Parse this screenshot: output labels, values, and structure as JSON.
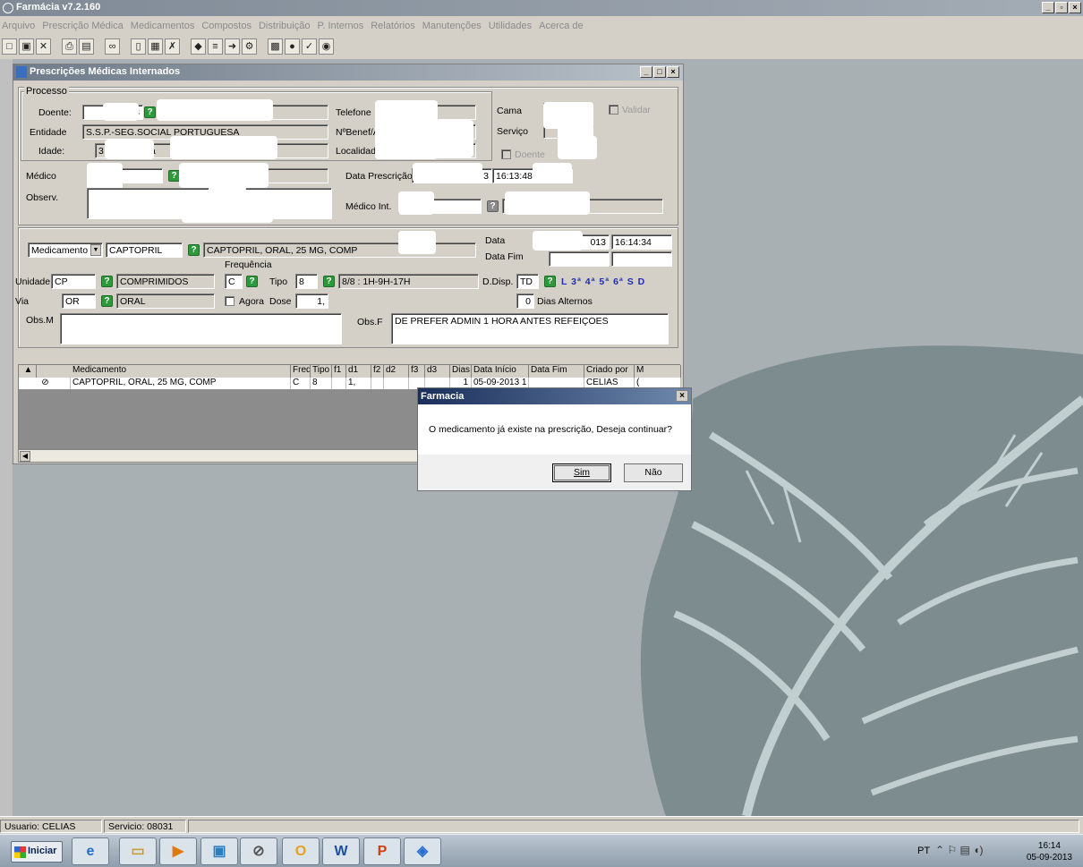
{
  "app": {
    "title": "Farmácia v7.2.160"
  },
  "menu": [
    "Arquivo",
    "Prescrição Médica",
    "Medicamentos",
    "Compostos",
    "Distribuição",
    "P. Internos",
    "Relatórios",
    "Manutenções",
    "Utilidades",
    "Acerca de"
  ],
  "toolbar": {
    "buttons": [
      "new-icon",
      "save-icon",
      "delete-icon",
      "print-icon",
      "print-preview-icon",
      "binoculars-icon",
      "page-icon",
      "export-icon",
      "excel-icon",
      "tool-icon",
      "tool-icon",
      "exit-icon",
      "tool-icon",
      "calculator-icon",
      "color-icon",
      "check-icon",
      "ok-icon"
    ]
  },
  "window": {
    "title": "Prescrições Médicas Internados"
  },
  "process": {
    "group_label": "Processo",
    "doente_label": "Doente:",
    "doente_value": "3",
    "entidade_label": "Entidade",
    "entidade_value": "S.S.P.-SEG.SOCIAL PORTUGUESA",
    "idade_label": "Idade:",
    "idade_value": "3",
    "idade_suffix": "a",
    "telefone_label": "Telefone",
    "nbenef_label": "NºBenef/A",
    "localidade_label": "Localidade:",
    "cama_label": "Cama",
    "validar_label": "Validar",
    "servico_label": "Serviço",
    "doente_chk_label": "Doente",
    "medico_label": "Médico",
    "observ_label": "Observ.",
    "data_prescricao_label": "Data Prescrição",
    "data_prescricao_date": "3",
    "data_prescricao_time": "16:13:48",
    "medico_int_label": "Médico Int."
  },
  "med": {
    "type_select": "Medicamento",
    "code": "CAPTOPRIL",
    "description": "CAPTOPRIL, ORAL,  25 MG, COMP",
    "data_label": "Data",
    "data_date": "013",
    "data_time": "16:14:34",
    "data_fim_label": "Data Fim",
    "frequencia_label": "Frequência",
    "unidade_label": "Unidade",
    "unidade_code": "CP",
    "unidade_desc": "COMPRIMIDOS",
    "freq_value": "C",
    "tipo_label": "Tipo",
    "tipo_value": "8",
    "tipo_desc": "8/8 : 1H-9H-17H",
    "ddisp_label": "D.Disp.",
    "ddisp_value": "TD",
    "weekdays": "L  3ª  4ª  5ª 6ª  S  D",
    "via_label": "Via",
    "via_code": "OR",
    "via_desc": "ORAL",
    "agora_label": "Agora",
    "dose_label": "Dose",
    "dose_value": "1,",
    "dias_alt_value": "0",
    "dias_alt_label": "Dias Alternos",
    "obsm_label": "Obs.M",
    "obsf_label": "Obs.F",
    "obsf_value": "DE PREFER ADMIN 1 HORA ANTES REFEIÇOES"
  },
  "grid": {
    "columns": [
      "Medicamento",
      "Freq",
      "Tipo",
      "f1",
      "d1",
      "f2",
      "d2",
      "f3",
      "d3",
      "Dias",
      "Data Início",
      "Data Fim",
      "Criado por",
      "M"
    ],
    "rows": [
      [
        "CAPTOPRIL, ORAL,  25 MG, COMP",
        "C",
        "8",
        "",
        "1,",
        "",
        "",
        "",
        "",
        "1",
        "05-09-2013 1",
        "",
        "CELIAS",
        "("
      ]
    ]
  },
  "dialog": {
    "title": "Farmacia",
    "message": "O medicamento já existe na prescrição, Deseja continuar?",
    "yes_label": "Sim",
    "no_label": "Não"
  },
  "status": {
    "user": "Usuario: CELIAS",
    "service": "Servicio: 08031"
  },
  "taskbar": {
    "start_label": "Iniciar",
    "lang": "PT",
    "time": "16:14",
    "date": "05-09-2013",
    "apps": [
      "ie-icon",
      "folder-icon",
      "media-player-icon",
      "network-app-icon",
      "pharmacy-app-icon",
      "outlook-icon",
      "word-icon",
      "powerpoint-icon",
      "windows-app-icon"
    ]
  },
  "colors": {
    "desktop": "#a9b0b3",
    "leaf": "#7d8c8e",
    "leaf_vein": "#c2cfd0",
    "help_green": "#2c9a3a",
    "weekday_blue": "#1c2fb0"
  }
}
